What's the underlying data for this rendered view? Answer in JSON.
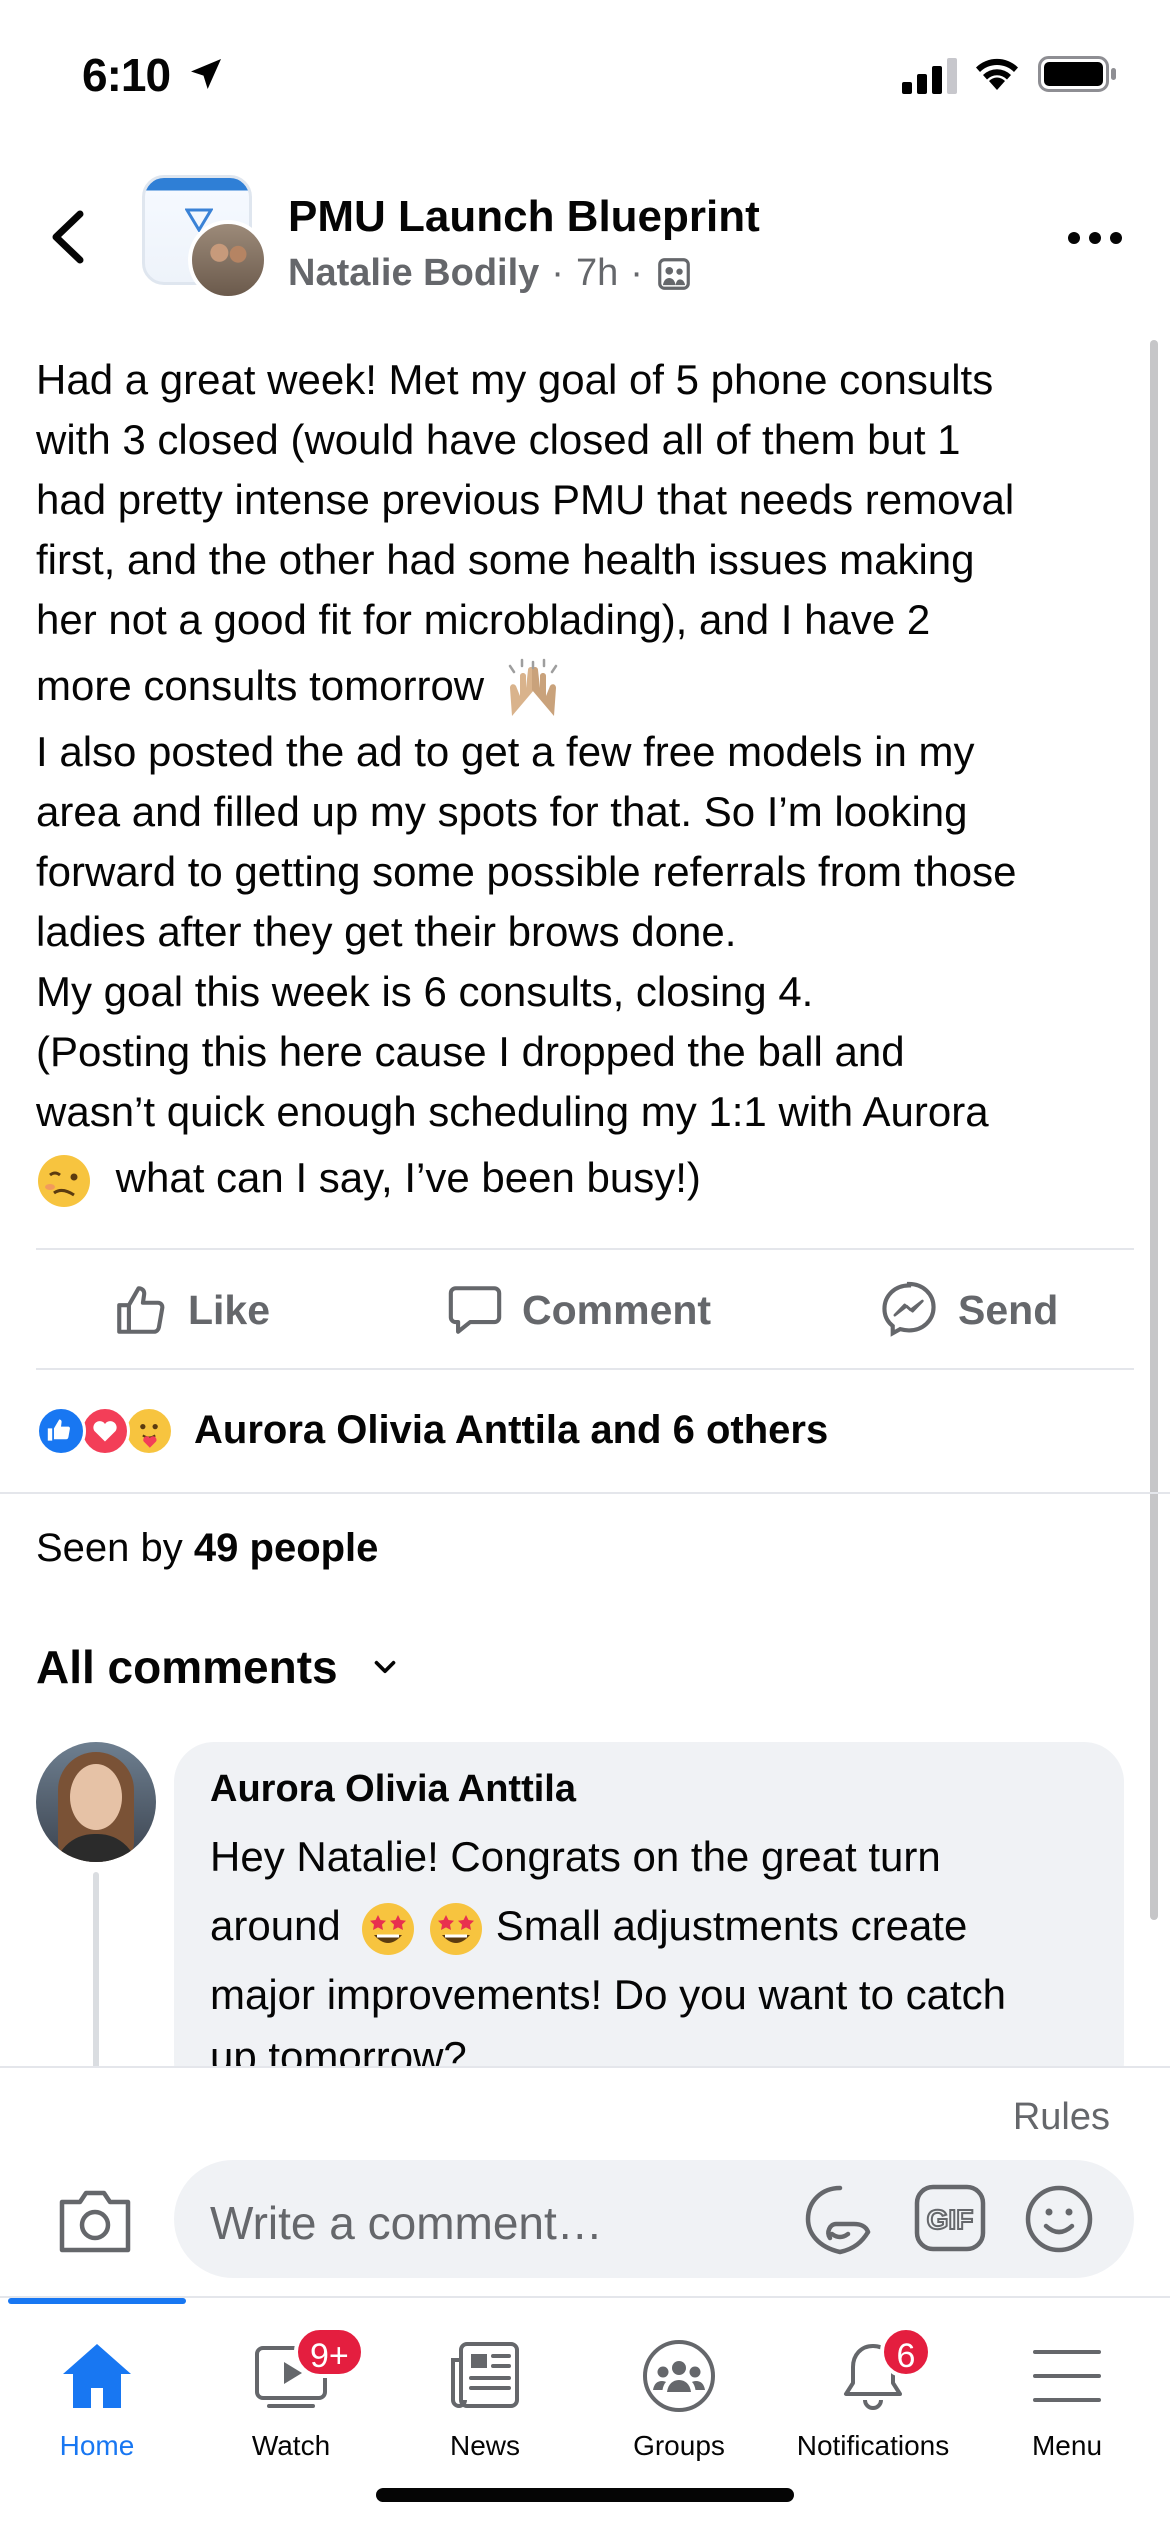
{
  "status_bar": {
    "time": "6:10"
  },
  "post": {
    "group_name": "PMU Launch Blueprint",
    "author": "Natalie Bodily",
    "time_ago": "7h",
    "separator": "·",
    "body_lines": [
      "Had a great week! Met my goal of 5 phone consults",
      "with 3 closed (would have closed all of them but 1",
      "had pretty intense previous PMU that needs removal",
      "first, and the other had some health issues making",
      "her not a good fit for microblading), and I have 2",
      "more consults tomorrow",
      "I also posted the ad to get a few free models in my",
      "area and filled up my spots for that.  So I’m looking",
      "forward to getting some possible referrals from those",
      "ladies after they get their brows done.",
      "My goal this week is 6 consults, closing 4.",
      "(Posting this here cause I dropped the ball and",
      "wasn’t quick enough scheduling my 1:1 with Aurora",
      "what can I say, I’ve been busy!)"
    ]
  },
  "actions": {
    "like": "Like",
    "comment": "Comment",
    "send": "Send"
  },
  "reactions": {
    "summary": "Aurora Olivia Anttila and 6 others"
  },
  "seen_by": {
    "prefix": "Seen by",
    "count": "49 people"
  },
  "comments_header": {
    "label": "All comments"
  },
  "comment": {
    "author": "Aurora Olivia Anttila",
    "lines": [
      "Hey Natalie! Congrats on the great turn",
      "around",
      "Small adjustments create",
      "major improvements! Do you want to catch",
      "up tomorrow?"
    ]
  },
  "composer": {
    "rules": "Rules",
    "placeholder": "Write a comment…"
  },
  "tabs": [
    {
      "label": "Home"
    },
    {
      "label": "Watch",
      "badge": "9+"
    },
    {
      "label": "News"
    },
    {
      "label": "Groups"
    },
    {
      "label": "Notifications",
      "badge": "6"
    },
    {
      "label": "Menu"
    }
  ],
  "colors": {
    "accent": "#1877f2",
    "badge": "#e41e3f",
    "secondary_text": "#65676b",
    "bubble": "#f0f2f5"
  },
  "icons": {
    "like": "thumbs-up-icon",
    "comment": "speech-bubble-icon",
    "send": "messenger-icon",
    "camera": "camera-icon",
    "sticker": "sticker-icon",
    "gif": "gif-icon",
    "emoji": "smiley-icon"
  }
}
